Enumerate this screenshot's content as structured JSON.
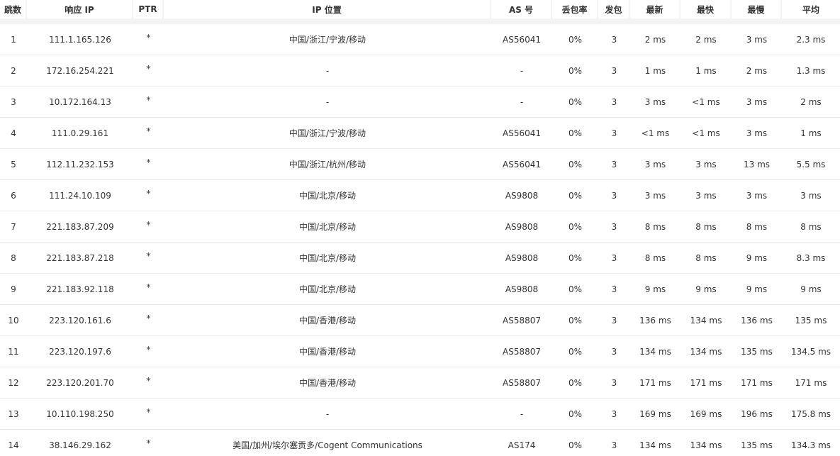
{
  "header": {
    "hop": "跳数",
    "ip": "响应 IP",
    "ptr": "PTR",
    "location": "IP 位置",
    "asn": "AS 号",
    "loss": "丢包率",
    "sent": "发包",
    "last": "最新",
    "best": "最快",
    "worst": "最慢",
    "avg": "平均"
  },
  "rows": [
    {
      "hop": "1",
      "ip": "111.1.165.126",
      "ptr": "*",
      "location": "中国/浙江/宁波/移动",
      "asn": "AS56041",
      "loss": "0%",
      "sent": "3",
      "last": "2 ms",
      "best": "2 ms",
      "worst": "3 ms",
      "avg": "2.3 ms"
    },
    {
      "hop": "2",
      "ip": "172.16.254.221",
      "ptr": "*",
      "location": "-",
      "asn": "-",
      "loss": "0%",
      "sent": "3",
      "last": "1 ms",
      "best": "1 ms",
      "worst": "2 ms",
      "avg": "1.3 ms"
    },
    {
      "hop": "3",
      "ip": "10.172.164.13",
      "ptr": "*",
      "location": "-",
      "asn": "-",
      "loss": "0%",
      "sent": "3",
      "last": "3 ms",
      "best": "<1 ms",
      "worst": "3 ms",
      "avg": "2 ms"
    },
    {
      "hop": "4",
      "ip": "111.0.29.161",
      "ptr": "*",
      "location": "中国/浙江/宁波/移动",
      "asn": "AS56041",
      "loss": "0%",
      "sent": "3",
      "last": "<1 ms",
      "best": "<1 ms",
      "worst": "3 ms",
      "avg": "1 ms"
    },
    {
      "hop": "5",
      "ip": "112.11.232.153",
      "ptr": "*",
      "location": "中国/浙江/杭州/移动",
      "asn": "AS56041",
      "loss": "0%",
      "sent": "3",
      "last": "3 ms",
      "best": "3 ms",
      "worst": "13 ms",
      "avg": "5.5 ms"
    },
    {
      "hop": "6",
      "ip": "111.24.10.109",
      "ptr": "*",
      "location": "中国/北京/移动",
      "asn": "AS9808",
      "loss": "0%",
      "sent": "3",
      "last": "3 ms",
      "best": "3 ms",
      "worst": "3 ms",
      "avg": "3 ms"
    },
    {
      "hop": "7",
      "ip": "221.183.87.209",
      "ptr": "*",
      "location": "中国/北京/移动",
      "asn": "AS9808",
      "loss": "0%",
      "sent": "3",
      "last": "8 ms",
      "best": "8 ms",
      "worst": "8 ms",
      "avg": "8 ms"
    },
    {
      "hop": "8",
      "ip": "221.183.87.218",
      "ptr": "*",
      "location": "中国/北京/移动",
      "asn": "AS9808",
      "loss": "0%",
      "sent": "3",
      "last": "8 ms",
      "best": "8 ms",
      "worst": "9 ms",
      "avg": "8.3 ms"
    },
    {
      "hop": "9",
      "ip": "221.183.92.118",
      "ptr": "*",
      "location": "中国/北京/移动",
      "asn": "AS9808",
      "loss": "0%",
      "sent": "3",
      "last": "9 ms",
      "best": "9 ms",
      "worst": "9 ms",
      "avg": "9 ms"
    },
    {
      "hop": "10",
      "ip": "223.120.161.6",
      "ptr": "*",
      "location": "中国/香港/移动",
      "asn": "AS58807",
      "loss": "0%",
      "sent": "3",
      "last": "136 ms",
      "best": "134 ms",
      "worst": "136 ms",
      "avg": "135 ms"
    },
    {
      "hop": "11",
      "ip": "223.120.197.6",
      "ptr": "*",
      "location": "中国/香港/移动",
      "asn": "AS58807",
      "loss": "0%",
      "sent": "3",
      "last": "134 ms",
      "best": "134 ms",
      "worst": "135 ms",
      "avg": "134.5 ms"
    },
    {
      "hop": "12",
      "ip": "223.120.201.70",
      "ptr": "*",
      "location": "中国/香港/移动",
      "asn": "AS58807",
      "loss": "0%",
      "sent": "3",
      "last": "171 ms",
      "best": "171 ms",
      "worst": "171 ms",
      "avg": "171 ms"
    },
    {
      "hop": "13",
      "ip": "10.110.198.250",
      "ptr": "*",
      "location": "-",
      "asn": "-",
      "loss": "0%",
      "sent": "3",
      "last": "169 ms",
      "best": "169 ms",
      "worst": "196 ms",
      "avg": "175.8 ms"
    },
    {
      "hop": "14",
      "ip": "38.146.29.162",
      "ptr": "*",
      "location": "美国/加州/埃尔塞贡多/Cogent Communications",
      "asn": "AS174",
      "loss": "0%",
      "sent": "3",
      "last": "134 ms",
      "best": "134 ms",
      "worst": "135 ms",
      "avg": "134.3 ms"
    }
  ]
}
